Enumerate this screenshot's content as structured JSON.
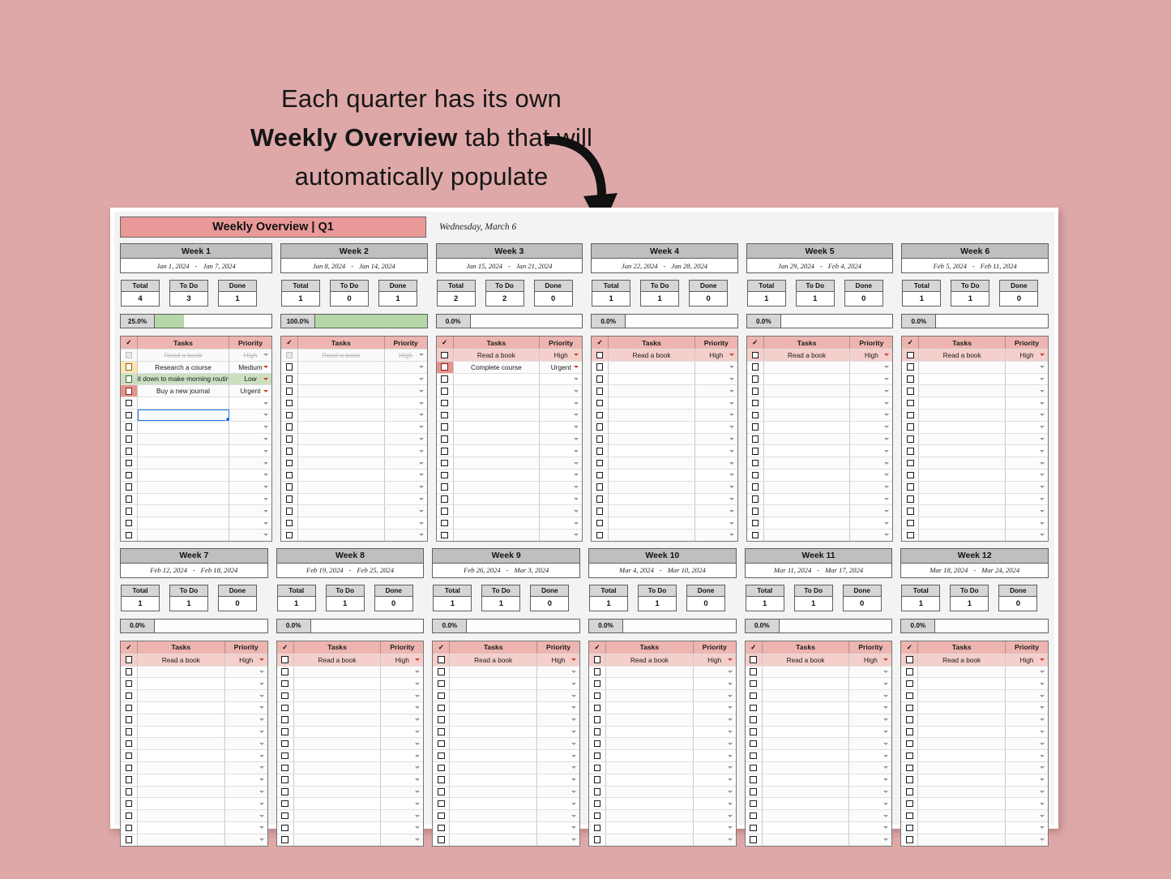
{
  "promo": {
    "line1": "Each quarter has its own",
    "line2_bold": "Weekly Overview",
    "line2_rest": " tab that will",
    "line3": "automatically populate"
  },
  "sheet": {
    "title": "Weekly Overview | Q1",
    "today": "Wednesday, March 6",
    "colors": {
      "background": "#dfa8a8",
      "title_bar": "#ea9999",
      "week_header": "#bfbfbf",
      "progress_fill": "#b6d7a8",
      "task_header": "#eeb5b0",
      "high": "#f5cfcb",
      "urgent": "#e8938c",
      "medium": "#fde5b0",
      "low": "#ccdfc1"
    },
    "stat_labels": {
      "total": "Total",
      "todo": "To Do",
      "done": "Done"
    },
    "task_headers": {
      "check": "✓",
      "tasks": "Tasks",
      "priority": "Priority"
    },
    "rows_per_week": 16,
    "weeks": [
      {
        "name": "Week 1",
        "start": "Jan 1, 2024",
        "end": "Jan 7, 2024",
        "dash": "-",
        "total": "4",
        "todo": "3",
        "done": "1",
        "percent": "25.0%",
        "percent_value": 25,
        "tasks": [
          {
            "task": "Read a book",
            "priority": "High",
            "state": "done"
          },
          {
            "task": "Research a course",
            "priority": "Medium",
            "state": "medium"
          },
          {
            "task": "Sit down to make morning routine",
            "priority": "Low",
            "state": "low"
          },
          {
            "task": "Buy a new journal",
            "priority": "Urgent",
            "state": "urgent"
          }
        ],
        "selected_row": 6
      },
      {
        "name": "Week 2",
        "start": "Jan 8, 2024",
        "end": "Jan 14, 2024",
        "dash": "-",
        "total": "1",
        "todo": "0",
        "done": "1",
        "percent": "100.0%",
        "percent_value": 100,
        "tasks": [
          {
            "task": "Read a book",
            "priority": "High",
            "state": "done"
          }
        ]
      },
      {
        "name": "Week 3",
        "start": "Jan 15, 2024",
        "end": "Jan 21, 2024",
        "dash": "-",
        "total": "2",
        "todo": "2",
        "done": "0",
        "percent": "0.0%",
        "percent_value": 0,
        "tasks": [
          {
            "task": "Read a book",
            "priority": "High",
            "state": "high"
          },
          {
            "task": "Complete course",
            "priority": "Urgent",
            "state": "urgent"
          }
        ]
      },
      {
        "name": "Week 4",
        "start": "Jan 22, 2024",
        "end": "Jan 28, 2024",
        "dash": "-",
        "total": "1",
        "todo": "1",
        "done": "0",
        "percent": "0.0%",
        "percent_value": 0,
        "tasks": [
          {
            "task": "Read a book",
            "priority": "High",
            "state": "high"
          }
        ]
      },
      {
        "name": "Week 5",
        "start": "Jan 29, 2024",
        "end": "Feb 4, 2024",
        "dash": "-",
        "total": "1",
        "todo": "1",
        "done": "0",
        "percent": "0.0%",
        "percent_value": 0,
        "tasks": [
          {
            "task": "Read a book",
            "priority": "High",
            "state": "high"
          }
        ]
      },
      {
        "name": "Week 6",
        "start": "Feb 5, 2024",
        "end": "Feb 11, 2024",
        "dash": "-",
        "total": "1",
        "todo": "1",
        "done": "0",
        "percent": "0.0%",
        "percent_value": 0,
        "tasks": [
          {
            "task": "Read a book",
            "priority": "High",
            "state": "high"
          }
        ]
      },
      {
        "name": "Week 7",
        "start": "Feb 12, 2024",
        "end": "Feb 18, 2024",
        "dash": "-",
        "total": "1",
        "todo": "1",
        "done": "0",
        "percent": "0.0%",
        "percent_value": 0,
        "tasks": [
          {
            "task": "Read a book",
            "priority": "High",
            "state": "high"
          }
        ]
      },
      {
        "name": "Week 8",
        "start": "Feb 19, 2024",
        "end": "Feb 25, 2024",
        "dash": "-",
        "total": "1",
        "todo": "1",
        "done": "0",
        "percent": "0.0%",
        "percent_value": 0,
        "tasks": [
          {
            "task": "Read a book",
            "priority": "High",
            "state": "high"
          }
        ]
      },
      {
        "name": "Week 9",
        "start": "Feb 26, 2024",
        "end": "Mar 3, 2024",
        "dash": "-",
        "total": "1",
        "todo": "1",
        "done": "0",
        "percent": "0.0%",
        "percent_value": 0,
        "tasks": [
          {
            "task": "Read a book",
            "priority": "High",
            "state": "high"
          }
        ]
      },
      {
        "name": "Week 10",
        "start": "Mar 4, 2024",
        "end": "Mar 10, 2024",
        "dash": "-",
        "total": "1",
        "todo": "1",
        "done": "0",
        "percent": "0.0%",
        "percent_value": 0,
        "tasks": [
          {
            "task": "Read a book",
            "priority": "High",
            "state": "high"
          }
        ]
      },
      {
        "name": "Week 11",
        "start": "Mar 11, 2024",
        "end": "Mar 17, 2024",
        "dash": "-",
        "total": "1",
        "todo": "1",
        "done": "0",
        "percent": "0.0%",
        "percent_value": 0,
        "tasks": [
          {
            "task": "Read a book",
            "priority": "High",
            "state": "high"
          }
        ]
      },
      {
        "name": "Week 12",
        "start": "Mar 18, 2024",
        "end": "Mar 24, 2024",
        "dash": "-",
        "total": "1",
        "todo": "1",
        "done": "0",
        "percent": "0.0%",
        "percent_value": 0,
        "tasks": [
          {
            "task": "Read a book",
            "priority": "High",
            "state": "high"
          }
        ]
      }
    ]
  }
}
